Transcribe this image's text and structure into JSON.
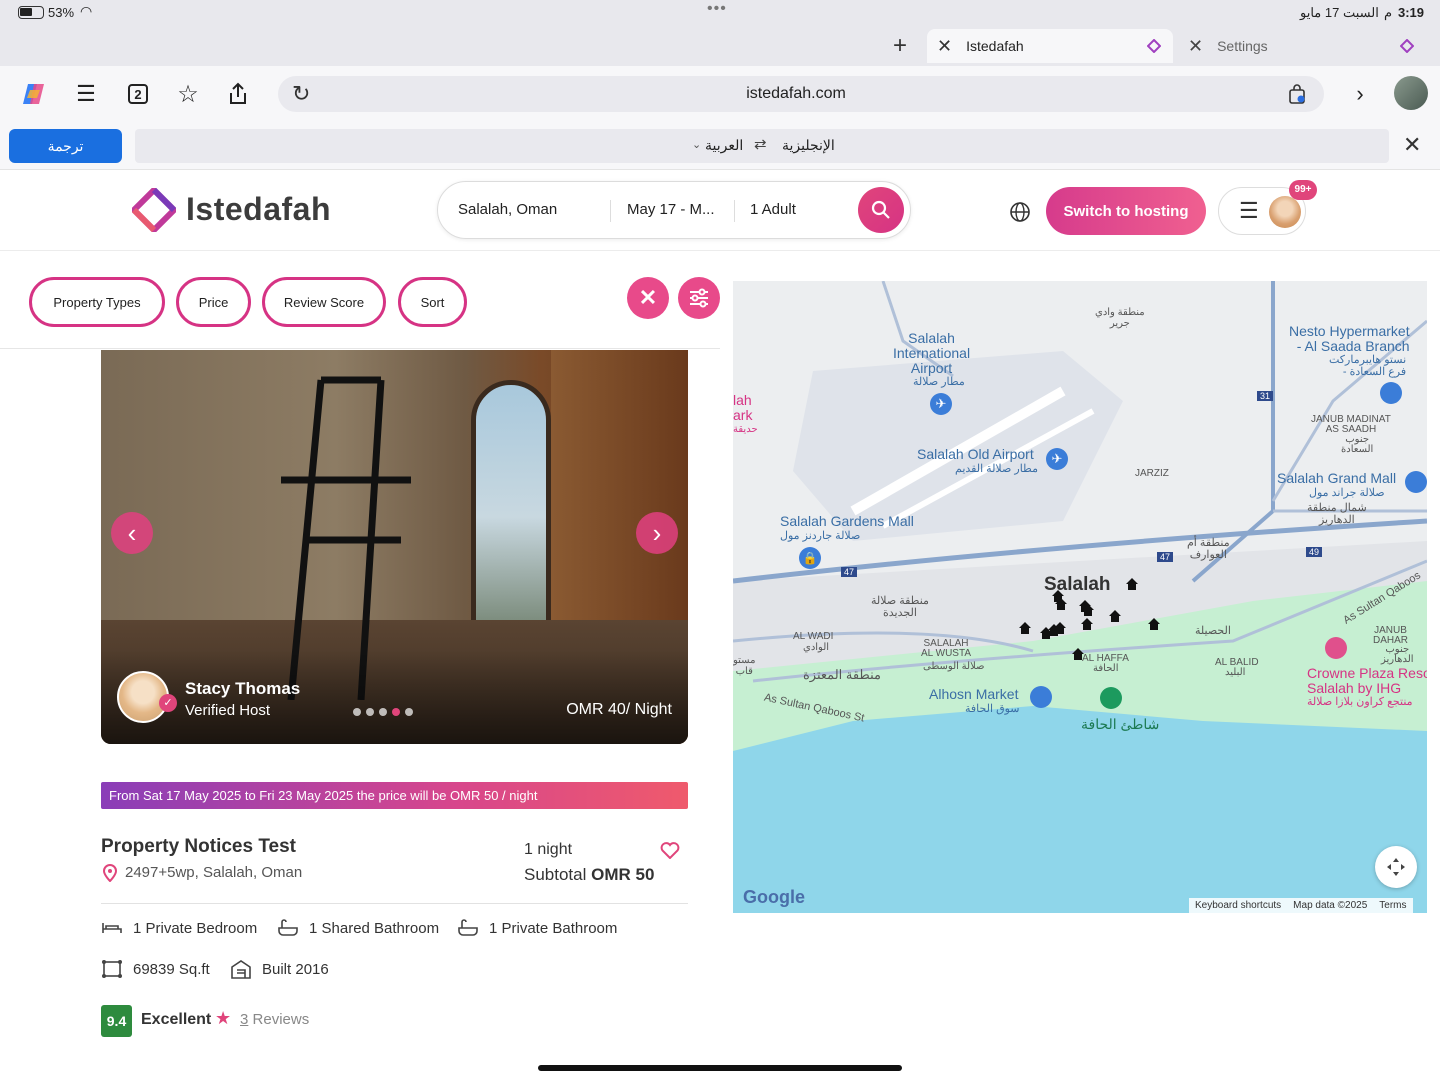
{
  "status": {
    "battery": "53%",
    "time": "3:19",
    "date": "السبت 17 مايو",
    "ampm": "م"
  },
  "tabs": [
    {
      "label": "Istedafah",
      "active": true
    },
    {
      "label": "Settings",
      "active": false
    }
  ],
  "toolbar": {
    "tab_count": "2",
    "url": "istedafah.com"
  },
  "translate": {
    "button": "ترجمة",
    "from": "العربية",
    "to": "الإنجليزية"
  },
  "site": {
    "logo": "Istedafah",
    "search": {
      "location": "Salalah, Oman",
      "dates": "May 17 - M...",
      "guests": "1 Adult"
    },
    "host_button": "Switch to hosting",
    "notif_badge": "99+"
  },
  "filters": [
    "Property Types",
    "Price",
    "Review Score",
    "Sort"
  ],
  "listing": {
    "host_name": "Stacy Thomas",
    "host_status": "Verified Host",
    "price_overlay": "OMR 40/ Night",
    "notice": "From Sat 17 May 2025 to Fri 23 May 2025 the price will be OMR 50 / night",
    "title": "Property Notices Test",
    "address": "2497+5wp, Salalah, Oman",
    "nights": "1 night",
    "subtotal_label": "Subtotal",
    "subtotal_value": "OMR 50",
    "features": [
      "1 Private Bedroom",
      "1 Shared Bathroom",
      "1 Private Bathroom"
    ],
    "area": "69839 Sq.ft",
    "built": "Built 2016",
    "score": "9.4",
    "rating_label": "Excellent",
    "reviews_count": "3",
    "reviews_label": "Reviews",
    "photo_dots": 5,
    "photo_active_dot": 4
  },
  "map": {
    "labels": {
      "airport": "Salalah\nInternational\nAirport",
      "airport_ar": "مطار صلالة",
      "old_airport": "Salalah Old Airport",
      "old_airport_ar": "مطار صلالة القديم",
      "gardens_mall": "Salalah Gardens Mall",
      "gardens_mall_ar": "صلالة جاردنز مول",
      "nesto": "Nesto Hypermarket\n- Al Saada Branch",
      "nesto_ar": "نستو هايبرماركت\n- فرع السعادة",
      "grand_mall": "Salalah Grand Mall",
      "grand_mall_ar": "صلالة جراند مول",
      "salalah": "Salalah",
      "jarziz": "JARZIZ",
      "janub": "JANUB MADINAT\nAS SAADH",
      "janub_ar": "جنوب\nالسعادة",
      "dahariz_ar": "شمال منطقة\nالدهاريز",
      "awaqir_ar": "منطقة أم\nالعوارف",
      "wadi_ar": "منطقة وادي\nجرير",
      "new_salalah_ar": "منطقة صلالة\nالجديدة",
      "al_wadi": "AL WADI",
      "al_wadi_ar": "الوادي",
      "salalah_wusta": "SALALAH\nAL WUSTA",
      "salalah_wusta_ar": "صلالة الوسطى",
      "al_haffa": "AL HAFFA",
      "al_haffa_ar": "الحافة",
      "al_balid": "AL BALID",
      "al_balid_ar": "البليد",
      "husaylah_ar": "الحصيلة",
      "maamurah_ar": "منطقة المعتزة",
      "alhosn": "Alhosn Market",
      "alhosn_ar": "سوق الحافة",
      "beach_ar": "شاطئ الحافة",
      "crowne": "Crowne Plaza Reso\nSalalah by IHG",
      "crowne_ar": "منتجع كراون بلازا صلالة",
      "sultan_qaboos": "As Sultan Qaboos St",
      "sultan_qaboos2": "As Sultan Qaboos",
      "janub_dahar": "JANUB\nDAHAR",
      "janub_dahar_ar": "جنوب\nالدهاريز",
      "park": "lah\nark",
      "park_ar": "حديقة",
      "road31": "31",
      "road47a": "47",
      "road47b": "47",
      "road49": "49",
      "left_ar": "مستو\nقاب"
    },
    "footer": {
      "shortcuts": "Keyboard shortcuts",
      "data": "Map data ©2025",
      "terms": "Terms"
    },
    "google": "Google"
  },
  "colors": {
    "brand": "#d63384",
    "score": "#2e8b3e",
    "water": "#8fd6ea",
    "green": "#c6efd2"
  }
}
